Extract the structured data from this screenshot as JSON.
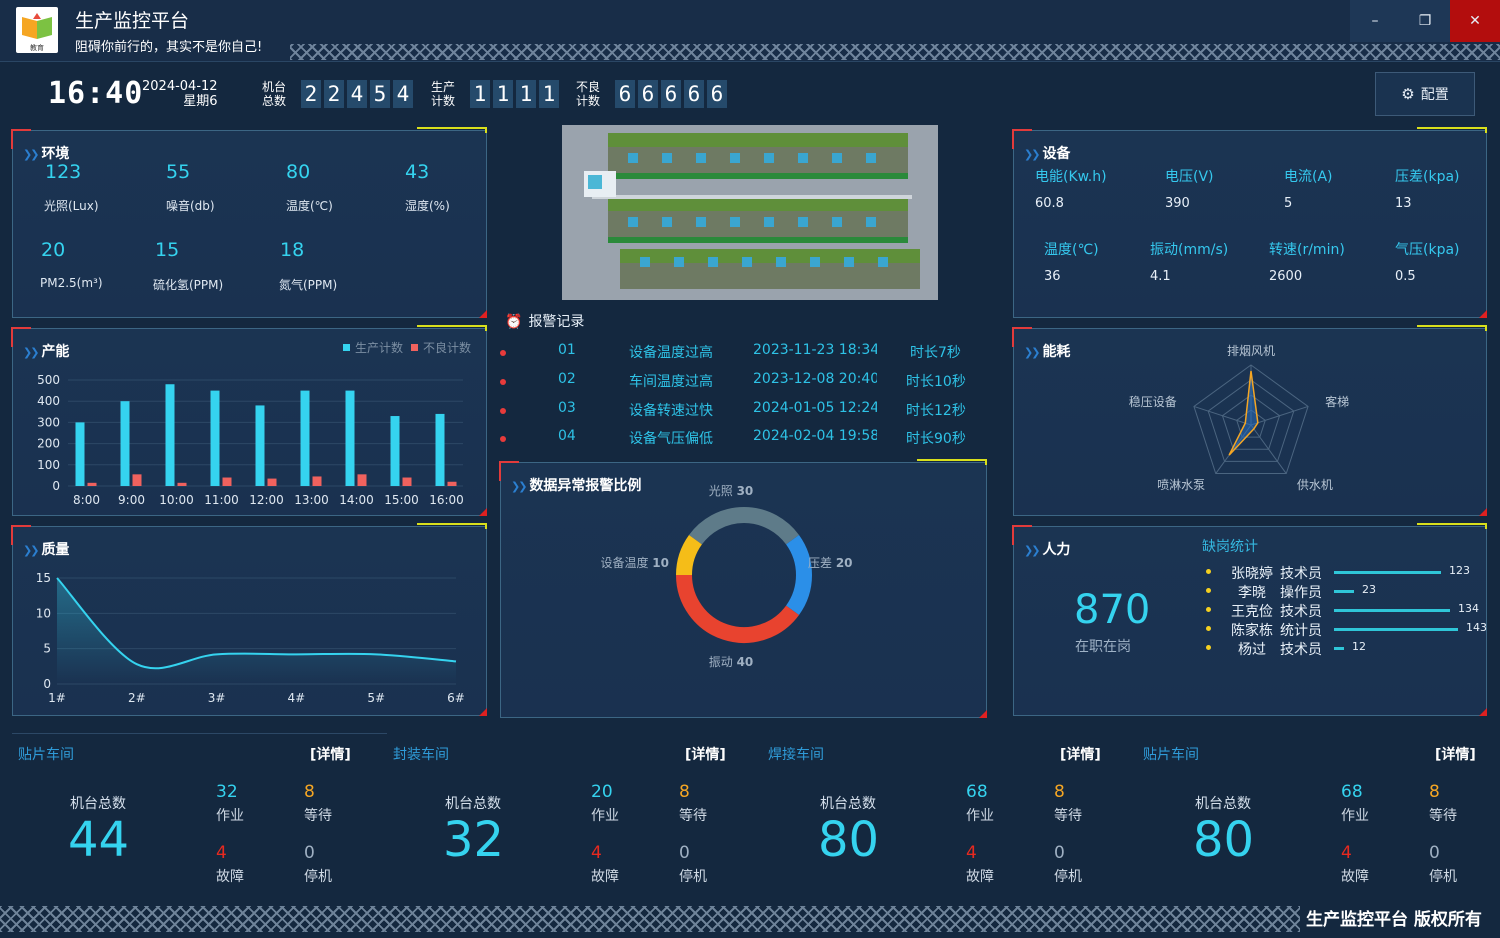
{
  "app": {
    "title": "生产监控平台",
    "subtitle": "阻碍你前行的，其实不是你自己!",
    "logo_text": "教育",
    "footer": "生产监控平台 版权所有"
  },
  "window": {
    "minimize": "–",
    "restore": "❐",
    "close": "✕"
  },
  "header": {
    "time": "16:40",
    "date": "2024-04-12",
    "weekday": "星期6",
    "machine_total": {
      "label1": "机台",
      "label2": "总数",
      "digits": [
        "2",
        "2",
        "4",
        "5",
        "4"
      ]
    },
    "production": {
      "label1": "生产",
      "label2": "计数",
      "digits": [
        "1",
        "1",
        "1",
        "1"
      ]
    },
    "defect": {
      "label1": "不良",
      "label2": "计数",
      "digits": [
        "6",
        "6",
        "6",
        "6",
        "6"
      ]
    },
    "config_label": "配置"
  },
  "env": {
    "title": "环境",
    "items": [
      {
        "value": "123",
        "label": "光照(Lux)"
      },
      {
        "value": "55",
        "label": "噪音(db)"
      },
      {
        "value": "80",
        "label": "温度(℃)"
      },
      {
        "value": "43",
        "label": "湿度(%)"
      },
      {
        "value": "20",
        "label": "PM2.5(m³)"
      },
      {
        "value": "15",
        "label": "硫化氢(PPM)"
      },
      {
        "value": "18",
        "label": "氮气(PPM)"
      }
    ]
  },
  "device": {
    "title": "设备",
    "items": [
      {
        "label": "电能(Kw.h)",
        "value": "60.8"
      },
      {
        "label": "电压(V)",
        "value": "390"
      },
      {
        "label": "电流(A)",
        "value": "5"
      },
      {
        "label": "压差(kpa)",
        "value": "13"
      },
      {
        "label": "温度(℃)",
        "value": "36"
      },
      {
        "label": "振动(mm/s)",
        "value": "4.1"
      },
      {
        "label": "转速(r/min)",
        "value": "2600"
      },
      {
        "label": "气压(kpa)",
        "value": "0.5"
      }
    ]
  },
  "alarm": {
    "title": "报警记录",
    "rows": [
      {
        "no": "01",
        "desc": "设备温度过高",
        "time": "2023-11-23 18:34",
        "dur": "时长7秒"
      },
      {
        "no": "02",
        "desc": "车间温度过高",
        "time": "2023-12-08 20:40",
        "dur": "时长10秒"
      },
      {
        "no": "03",
        "desc": "设备转速过快",
        "time": "2024-01-05 12:24",
        "dur": "时长12秒"
      },
      {
        "no": "04",
        "desc": "设备气压偏低",
        "time": "2024-02-04 19:58",
        "dur": "时长90秒"
      }
    ]
  },
  "capacity": {
    "title": "产能"
  },
  "quality": {
    "title": "质量"
  },
  "abnormal": {
    "title": "数据异常报警比例"
  },
  "energy": {
    "title": "能耗"
  },
  "hr": {
    "title": "人力",
    "count": "870",
    "count_label": "在职在岗",
    "absent_title": "缺岗统计",
    "rows": [
      {
        "name": "张晓婷",
        "role": "技术员",
        "value": 123
      },
      {
        "name": "李晓",
        "role": "操作员",
        "value": 23
      },
      {
        "name": "王克俭",
        "role": "技术员",
        "value": 134
      },
      {
        "name": "陈家栋",
        "role": "统计员",
        "value": 143
      },
      {
        "name": "杨过",
        "role": "技术员",
        "value": 12
      }
    ]
  },
  "workshops": [
    {
      "name": "贴片车间",
      "detail": "[详情]",
      "total_label": "机台总数",
      "total": "44",
      "working": "32",
      "working_label": "作业",
      "waiting": "8",
      "waiting_label": "等待",
      "fault": "4",
      "fault_label": "故障",
      "stop": "0",
      "stop_label": "停机"
    },
    {
      "name": "封装车间",
      "detail": "[详情]",
      "total_label": "机台总数",
      "total": "32",
      "working": "20",
      "working_label": "作业",
      "waiting": "8",
      "waiting_label": "等待",
      "fault": "4",
      "fault_label": "故障",
      "stop": "0",
      "stop_label": "停机"
    },
    {
      "name": "焊接车间",
      "detail": "[详情]",
      "total_label": "机台总数",
      "total": "80",
      "working": "68",
      "working_label": "作业",
      "waiting": "8",
      "waiting_label": "等待",
      "fault": "4",
      "fault_label": "故障",
      "stop": "0",
      "stop_label": "停机"
    },
    {
      "name": "贴片车间",
      "detail": "[详情]",
      "total_label": "机台总数",
      "total": "80",
      "working": "68",
      "working_label": "作业",
      "waiting": "8",
      "waiting_label": "等待",
      "fault": "4",
      "fault_label": "故障",
      "stop": "0",
      "stop_label": "停机"
    }
  ],
  "colors": {
    "accent": "#35d3ef",
    "orange": "#f5a623",
    "red": "#e83b3b",
    "bar_prod": "#35d3ef",
    "bar_bad": "#f0625e"
  },
  "chart_data": [
    {
      "type": "bar",
      "title": "产能",
      "categories": [
        "8:00",
        "9:00",
        "10:00",
        "11:00",
        "12:00",
        "13:00",
        "14:00",
        "15:00",
        "16:00"
      ],
      "series": [
        {
          "name": "生产计数",
          "values": [
            300,
            400,
            480,
            450,
            380,
            450,
            450,
            330,
            340
          ]
        },
        {
          "name": "不良计数",
          "values": [
            15,
            55,
            15,
            40,
            35,
            45,
            55,
            40,
            20
          ]
        }
      ],
      "ylim": [
        0,
        500
      ],
      "yticks": [
        0,
        100,
        200,
        300,
        400,
        500
      ],
      "legend": "top-right"
    },
    {
      "type": "line",
      "title": "质量",
      "categories": [
        "1#",
        "2#",
        "3#",
        "4#",
        "5#",
        "6#"
      ],
      "values": [
        15,
        2.8,
        4.2,
        4.2,
        4.2,
        3.2
      ],
      "ylim": [
        0,
        15
      ],
      "yticks": [
        0,
        5,
        10,
        15
      ]
    },
    {
      "type": "pie",
      "title": "数据异常报警比例",
      "slices": [
        {
          "label": "光照",
          "value": 30,
          "color": "#5e7b89"
        },
        {
          "label": "压差",
          "value": 20,
          "color": "#2b8fe8"
        },
        {
          "label": "振动",
          "value": 40,
          "color": "#e8432f"
        },
        {
          "label": "设备温度",
          "value": 10,
          "color": "#f5bd18"
        }
      ]
    },
    {
      "type": "radar",
      "title": "能耗",
      "axes": [
        "排烟风机",
        "客梯",
        "供水机",
        "喷淋水泵",
        "稳压设备"
      ],
      "series": [
        {
          "values": [
            90,
            12,
            8,
            62,
            10
          ],
          "color": "#f5a623"
        }
      ],
      "max": 100
    }
  ]
}
